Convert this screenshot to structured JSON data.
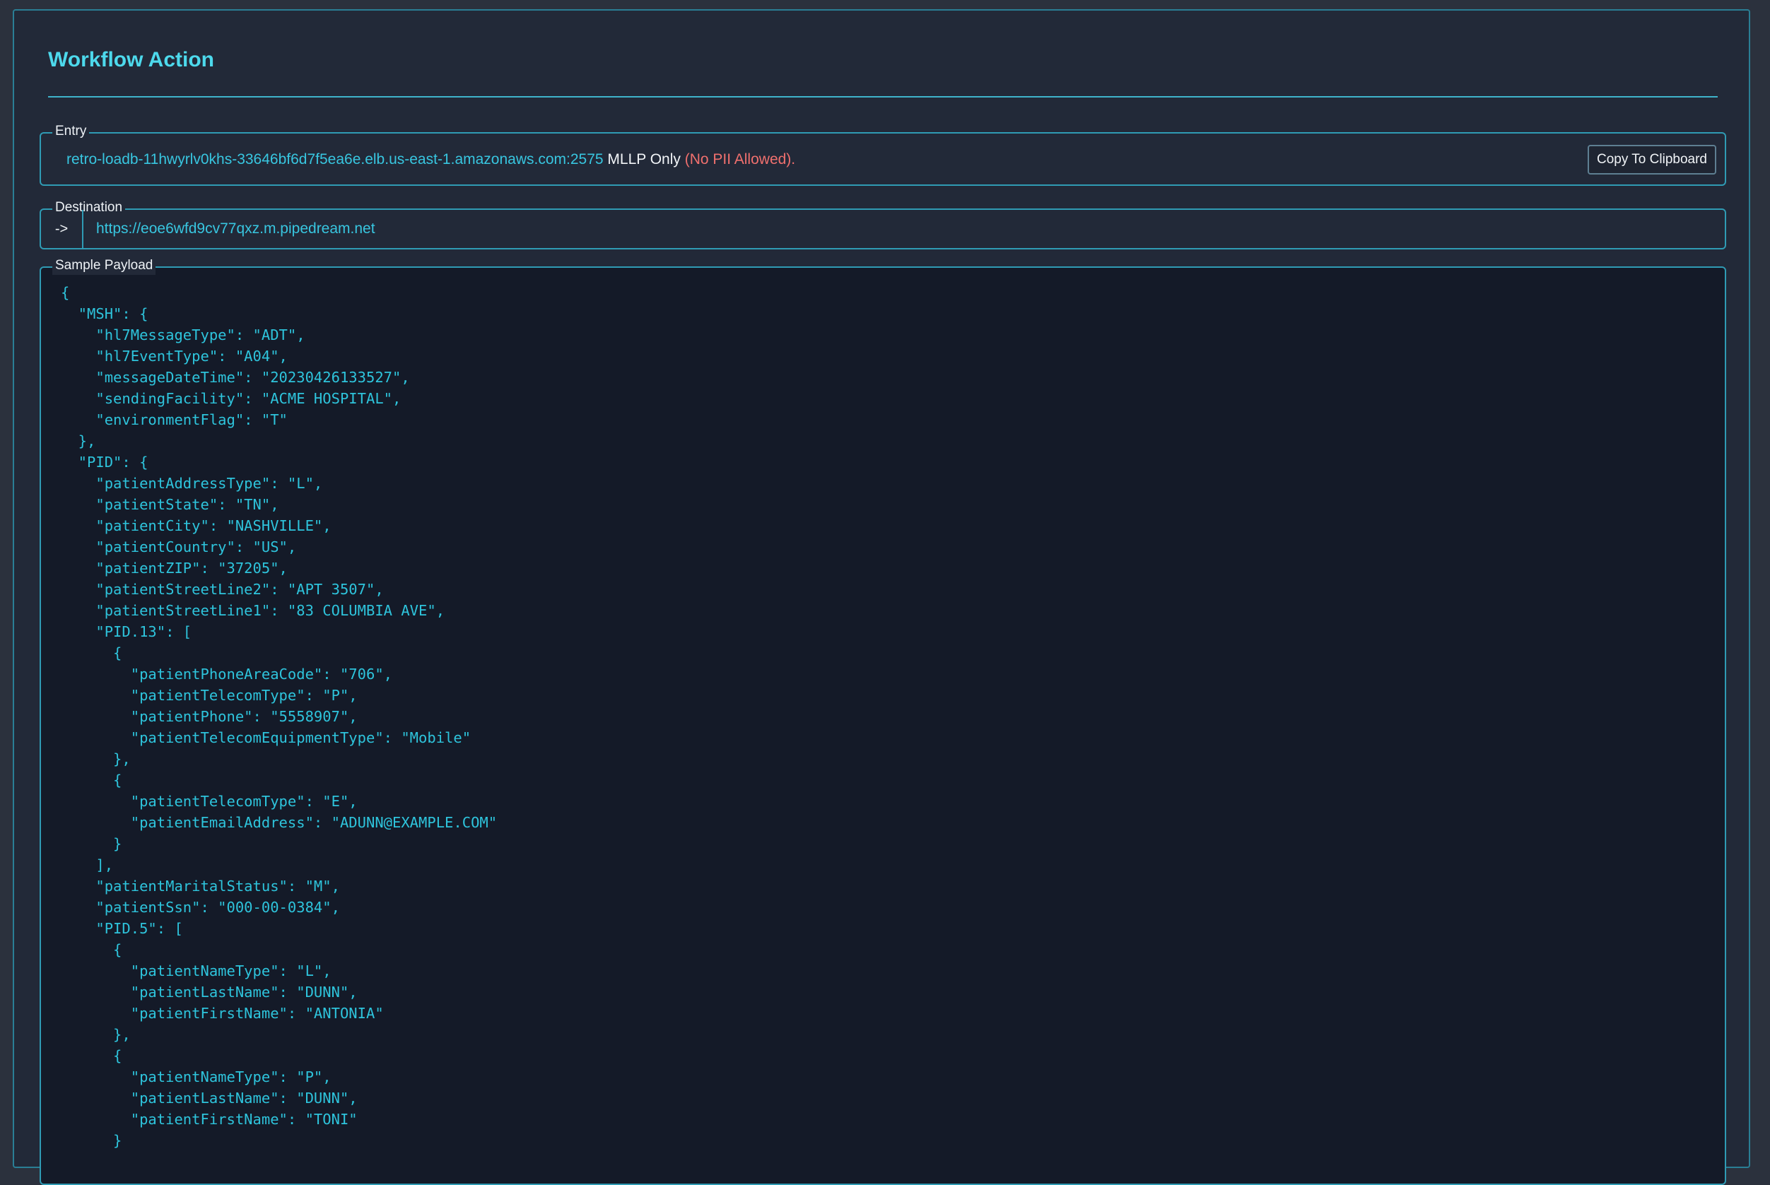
{
  "panel": {
    "title": "Workflow Action"
  },
  "entry": {
    "legend": "Entry",
    "host": "retro-loadb-11hwyrlv0khs-33646bf6d7f5ea6e.elb.us-east-1.amazonaws.com:2575",
    "protocol": " MLLP Only ",
    "pii_note": "(No PII Allowed).",
    "copy_label": "Copy To Clipboard"
  },
  "destination": {
    "legend": "Destination",
    "arrow": "->",
    "url": "https://eoe6wfd9cv77qxz.m.pipedream.net"
  },
  "payload": {
    "legend": "Sample Payload",
    "code": "{\n  \"MSH\": {\n    \"hl7MessageType\": \"ADT\",\n    \"hl7EventType\": \"A04\",\n    \"messageDateTime\": \"20230426133527\",\n    \"sendingFacility\": \"ACME HOSPITAL\",\n    \"environmentFlag\": \"T\"\n  },\n  \"PID\": {\n    \"patientAddressType\": \"L\",\n    \"patientState\": \"TN\",\n    \"patientCity\": \"NASHVILLE\",\n    \"patientCountry\": \"US\",\n    \"patientZIP\": \"37205\",\n    \"patientStreetLine2\": \"APT 3507\",\n    \"patientStreetLine1\": \"83 COLUMBIA AVE\",\n    \"PID.13\": [\n      {\n        \"patientPhoneAreaCode\": \"706\",\n        \"patientTelecomType\": \"P\",\n        \"patientPhone\": \"5558907\",\n        \"patientTelecomEquipmentType\": \"Mobile\"\n      },\n      {\n        \"patientTelecomType\": \"E\",\n        \"patientEmailAddress\": \"ADUNN@EXAMPLE.COM\"\n      }\n    ],\n    \"patientMaritalStatus\": \"M\",\n    \"patientSsn\": \"000-00-0384\",\n    \"PID.5\": [\n      {\n        \"patientNameType\": \"L\",\n        \"patientLastName\": \"DUNN\",\n        \"patientFirstName\": \"ANTONIA\"\n      },\n      {\n        \"patientNameType\": \"P\",\n        \"patientLastName\": \"DUNN\",\n        \"patientFirstName\": \"TONI\"\n      }"
  }
}
